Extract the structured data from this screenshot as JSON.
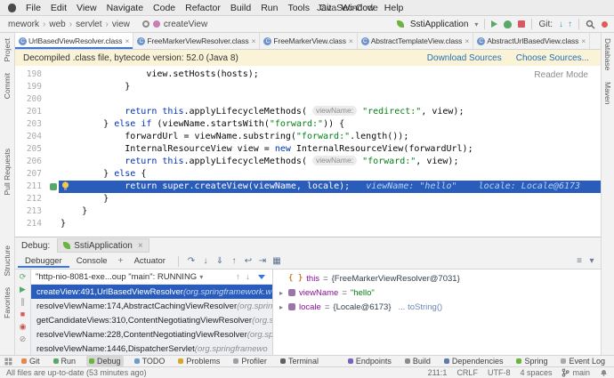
{
  "window": {
    "title": "JavaSec-Code"
  },
  "icons": {
    "chevron_down": "▾",
    "crumb_sep": "›",
    "close": "×",
    "expand_arrow": "▸",
    "add": "+",
    "class_letter": "C",
    "up": "↑",
    "down": "↓"
  },
  "menu": {
    "items": [
      "File",
      "Edit",
      "View",
      "Navigate",
      "Code",
      "Refactor",
      "Build",
      "Run",
      "Tools",
      "Git",
      "Window",
      "Help"
    ]
  },
  "toolbar": {
    "breadcrumbs": [
      "mework",
      "web",
      "servlet",
      "view"
    ],
    "context_method": "createView",
    "run_config": "SstiApplication",
    "git_label": "Git:",
    "vcs_icons": [
      {
        "name": "update-project-icon",
        "glyph": "↓"
      },
      {
        "name": "push-icon",
        "glyph": "↑"
      }
    ]
  },
  "editor_tabs": [
    {
      "label": "UrlBasedViewResolver.class",
      "active": true
    },
    {
      "label": "FreeMarkerViewResolver.class",
      "active": false
    },
    {
      "label": "FreeMarkerView.class",
      "active": false
    },
    {
      "label": "AbstractTemplateView.class",
      "active": false
    },
    {
      "label": "AbstractUrlBasedView.class",
      "active": false
    }
  ],
  "banner": {
    "message": "Decompiled .class file, bytecode version: 52.0 (Java 8)",
    "link1": "Download Sources",
    "link2": "Choose Sources...",
    "reader_mode": "Reader Mode"
  },
  "editor": {
    "lines": [
      {
        "num": "198",
        "tokens": [
          [
            "p",
            "                view.setHosts(hosts);"
          ]
        ]
      },
      {
        "num": "199",
        "tokens": [
          [
            "p",
            "            }"
          ]
        ]
      },
      {
        "num": "200",
        "tokens": []
      },
      {
        "num": "201",
        "tokens": [
          [
            "p",
            "            "
          ],
          [
            "k",
            "return"
          ],
          [
            "p",
            " "
          ],
          [
            "k",
            "this"
          ],
          [
            "p",
            ".applyLifecycleMethods( "
          ],
          [
            "h",
            "viewName:"
          ],
          [
            "p",
            " "
          ],
          [
            "s",
            "\"redirect:\""
          ],
          [
            "p",
            ", view);"
          ]
        ]
      },
      {
        "num": "203",
        "tokens": [
          [
            "p",
            "        } "
          ],
          [
            "k",
            "else"
          ],
          [
            "p",
            " "
          ],
          [
            "k",
            "if"
          ],
          [
            "p",
            " (viewName.startsWith("
          ],
          [
            "s",
            "\"forward:\""
          ],
          [
            "p",
            ")) {"
          ]
        ]
      },
      {
        "num": "204",
        "tokens": [
          [
            "p",
            "            forwardUrl = viewName.substring("
          ],
          [
            "s",
            "\"forward:\""
          ],
          [
            "p",
            ".length());"
          ]
        ]
      },
      {
        "num": "205",
        "tokens": [
          [
            "p",
            "            InternalResourceView view = "
          ],
          [
            "k",
            "new"
          ],
          [
            "p",
            " InternalResourceView(forwardUrl);"
          ]
        ]
      },
      {
        "num": "206",
        "tokens": [
          [
            "p",
            "            "
          ],
          [
            "k",
            "return"
          ],
          [
            "p",
            " "
          ],
          [
            "k",
            "this"
          ],
          [
            "p",
            ".applyLifecycleMethods( "
          ],
          [
            "h",
            "viewName:"
          ],
          [
            "p",
            " "
          ],
          [
            "s",
            "\"forward:\""
          ],
          [
            "p",
            ", view);"
          ]
        ]
      },
      {
        "num": "207",
        "tokens": [
          [
            "p",
            "        } "
          ],
          [
            "k",
            "else"
          ],
          [
            "p",
            " {"
          ]
        ]
      },
      {
        "num": "211",
        "exec": true,
        "tokens": [
          [
            "p",
            "            "
          ],
          [
            "k",
            "return"
          ],
          [
            "p",
            " "
          ],
          [
            "k",
            "super"
          ],
          [
            "p",
            ".createView(viewName, locale);"
          ],
          [
            "d",
            "   viewName: \"hello\"    locale: Locale@6173"
          ]
        ]
      },
      {
        "num": "212",
        "tokens": [
          [
            "p",
            "        }"
          ]
        ]
      },
      {
        "num": "213",
        "tokens": [
          [
            "p",
            "    }"
          ]
        ]
      },
      {
        "num": "214",
        "tokens": [
          [
            "p",
            "}"
          ]
        ]
      }
    ]
  },
  "debug": {
    "panel_label": "Debug:",
    "session_tab": "SstiApplication",
    "tabs": [
      {
        "label": "Debugger",
        "active": true
      },
      {
        "label": "Console",
        "active": false
      },
      {
        "label": "Actuator",
        "active": false
      }
    ],
    "frames": {
      "thread": "\"http-nio-8081-exe...oup \"main\": RUNNING",
      "items": [
        {
          "loc": "createView:491,",
          "cls": "UrlBasedViewResolver",
          "pkg": "(org.springframework.w",
          "selected": true
        },
        {
          "loc": "resolveViewName:174,",
          "cls": "AbstractCachingViewResolver",
          "pkg": "(org.spring",
          "selected": false
        },
        {
          "loc": "getCandidateViews:310,",
          "cls": "ContentNegotiatingViewResolver",
          "pkg": "(org.s",
          "selected": false
        },
        {
          "loc": "resolveViewName:228,",
          "cls": "ContentNegotiatingViewResolver",
          "pkg": "(org.sp",
          "selected": false
        },
        {
          "loc": "resolveViewName:1446,",
          "cls": "DispatcherServlet",
          "pkg": "(org.springframewo",
          "selected": false
        }
      ]
    },
    "variables": {
      "items": [
        {
          "arrow": false,
          "prefix": "{ }",
          "name": "this",
          "eq": " = ",
          "value": "{FreeMarkerViewResolver@7031}",
          "vtype": "object",
          "extra": ""
        },
        {
          "arrow": true,
          "prefix": "",
          "name": "viewName",
          "eq": " = ",
          "value": "\"hello\"",
          "vtype": "string",
          "extra": ""
        },
        {
          "arrow": true,
          "prefix": "",
          "name": "locale",
          "eq": " = ",
          "value": "{Locale@6173}",
          "vtype": "object",
          "extra": "... toString()"
        }
      ]
    }
  },
  "debug_toolbar": {
    "left_strip": [
      {
        "name": "rerun-icon",
        "glyph": "⟳",
        "color": "#59A869"
      },
      {
        "name": "resume-icon",
        "glyph": "▶",
        "color": "#59A869"
      },
      {
        "name": "pause-icon",
        "glyph": "∥",
        "color": "#8A8A8A"
      },
      {
        "name": "stop-icon",
        "glyph": "■",
        "color": "#DB5860"
      },
      {
        "name": "view-breakpoints-icon",
        "glyph": "◉",
        "color": "#C75450"
      },
      {
        "name": "mute-breakpoints-icon",
        "glyph": "⊘",
        "color": "#8A8A8A"
      }
    ],
    "step_icons": [
      {
        "name": "step-over-icon",
        "glyph": "↷"
      },
      {
        "name": "step-into-icon",
        "glyph": "↓"
      },
      {
        "name": "force-step-into-icon",
        "glyph": "⇓"
      },
      {
        "name": "step-out-icon",
        "glyph": "↑"
      },
      {
        "name": "drop-frame-icon",
        "glyph": "↩"
      },
      {
        "name": "run-to-cursor-icon",
        "glyph": "⇥"
      },
      {
        "name": "evaluate-expression-icon",
        "glyph": "▦"
      }
    ],
    "right_icons": [
      {
        "name": "layout-settings-icon",
        "glyph": "≡"
      },
      {
        "name": "hide-panel-icon",
        "glyph": "▾"
      }
    ],
    "frame_nav_icons": [
      {
        "name": "frame-up-icon",
        "glyph": "↑"
      },
      {
        "name": "frame-down-icon",
        "glyph": "↓"
      }
    ]
  },
  "tool_windows": {
    "left_groups": [
      [
        "Project",
        "Commit"
      ],
      [
        "Pull Requests"
      ],
      [
        "Structure",
        "Favorites"
      ]
    ],
    "right_items": [
      "Database",
      "Maven"
    ],
    "bottom_left": [
      {
        "label": "Git",
        "icon": "git-icon",
        "color": "#E8854B",
        "active": false
      },
      {
        "label": "Run",
        "icon": "run-icon",
        "color": "#59A869",
        "active": false
      },
      {
        "label": "Debug",
        "icon": "debug-icon",
        "color": "#6DB33F",
        "active": true
      },
      {
        "label": "TODO",
        "icon": "todo-icon",
        "color": "#6E9BC9",
        "active": false
      },
      {
        "label": "Problems",
        "icon": "problems-icon",
        "color": "#D6A52A",
        "active": false
      },
      {
        "label": "Profiler",
        "icon": "profiler-icon",
        "color": "#9AA0A6",
        "active": false
      },
      {
        "label": "Terminal",
        "icon": "terminal-icon",
        "color": "#616161",
        "active": false
      }
    ],
    "bottom_right": [
      {
        "label": "Endpoints",
        "icon": "endpoints-icon",
        "color": "#7A64C0",
        "active": false
      },
      {
        "label": "Build",
        "icon": "build-icon",
        "color": "#8C8C8C",
        "active": false
      },
      {
        "label": "Dependencies",
        "icon": "dependencies-icon",
        "color": "#5E7CA8",
        "active": false
      },
      {
        "label": "Spring",
        "icon": "spring-icon",
        "color": "#6DB33F",
        "active": false
      },
      {
        "label": "Event Log",
        "icon": "eventlog-icon",
        "color": "#A9A9A9",
        "active": false
      }
    ]
  },
  "status_bar": {
    "message": "All files are up-to-date (53 minutes ago)",
    "position": "211:1",
    "line_ending": "CRLF",
    "encoding": "UTF-8",
    "indent": "4 spaces",
    "branch": "main"
  }
}
